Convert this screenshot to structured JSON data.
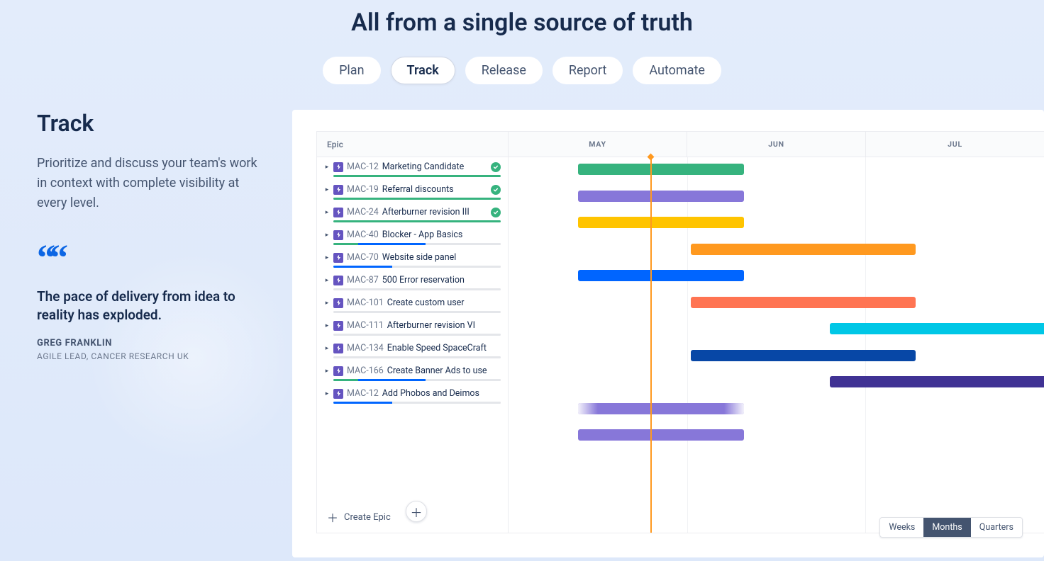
{
  "header": {
    "title": "All from a single source of truth",
    "tabs": [
      "Plan",
      "Track",
      "Release",
      "Report",
      "Automate"
    ],
    "active_tab": "Track"
  },
  "left": {
    "heading": "Track",
    "description": "Prioritize and discuss your team's work in context with complete visibility at every level.",
    "quote": {
      "text": "The pace of delivery from idea to reality has exploded.",
      "name": "GREG FRANKLIN",
      "role": "AGILE LEAD, CANCER RESEARCH UK"
    }
  },
  "roadmap": {
    "epic_header": "Epic",
    "create_epic_label": "Create Epic",
    "months": [
      "MAY",
      "JUN",
      "JUL"
    ],
    "today_pct": 26.5,
    "zoom": {
      "options": [
        "Weeks",
        "Months",
        "Quarters"
      ],
      "active": "Months"
    },
    "colors": {
      "green": "#36b37e",
      "purple": "#8777d9",
      "yellow": "#ffc400",
      "orange": "#ff991f",
      "blue": "#0065ff",
      "coral": "#ff7452",
      "teal": "#00c7e6",
      "navy": "#0747a6",
      "indigo": "#403294"
    },
    "epics": [
      {
        "key": "MAC-12",
        "title": "Marketing Candidate",
        "done": true,
        "progress": [
          [
            "#36b37e",
            100
          ]
        ],
        "bar": {
          "color": "green",
          "start_pct": 13,
          "width_pct": 31
        }
      },
      {
        "key": "MAC-19",
        "title": "Referral discounts",
        "done": true,
        "progress": [
          [
            "#36b37e",
            100
          ]
        ],
        "bar": {
          "color": "purple",
          "start_pct": 13,
          "width_pct": 31
        }
      },
      {
        "key": "MAC-24",
        "title": "Afterburner revision III",
        "done": true,
        "progress": [
          [
            "#36b37e",
            100
          ]
        ],
        "bar": {
          "color": "yellow",
          "start_pct": 13,
          "width_pct": 31
        }
      },
      {
        "key": "MAC-40",
        "title": "Blocker - App Basics",
        "done": false,
        "progress": [
          [
            "#36b37e",
            15
          ],
          [
            "#0065ff",
            40
          ],
          [
            "#e4e6ea",
            45
          ]
        ],
        "bar": {
          "color": "orange",
          "start_pct": 34,
          "width_pct": 42
        }
      },
      {
        "key": "MAC-70",
        "title": "Website side panel",
        "done": false,
        "progress": [
          [
            "#0065ff",
            35
          ],
          [
            "#e4e6ea",
            65
          ]
        ],
        "bar": {
          "color": "blue",
          "start_pct": 13,
          "width_pct": 31
        }
      },
      {
        "key": "MAC-87",
        "title": "500 Error reservation",
        "done": false,
        "progress": [
          [
            "#e4e6ea",
            100
          ]
        ],
        "bar": {
          "color": "coral",
          "start_pct": 34,
          "width_pct": 42
        }
      },
      {
        "key": "MAC-101",
        "title": "Create custom user",
        "done": false,
        "progress": [
          [
            "#e4e6ea",
            100
          ]
        ],
        "bar": {
          "color": "teal",
          "start_pct": 60,
          "width_pct": 42
        }
      },
      {
        "key": "MAC-111",
        "title": "Afterburner revision VI",
        "done": false,
        "progress": [
          [
            "#e4e6ea",
            100
          ]
        ],
        "bar": {
          "color": "navy",
          "start_pct": 34,
          "width_pct": 42
        }
      },
      {
        "key": "MAC-134",
        "title": "Enable Speed SpaceCraft",
        "done": false,
        "progress": [
          [
            "#e4e6ea",
            100
          ]
        ],
        "bar": {
          "color": "indigo",
          "start_pct": 60,
          "width_pct": 42
        }
      },
      {
        "key": "MAC-166",
        "title": "Create Banner Ads to use",
        "done": false,
        "progress": [
          [
            "#36b37e",
            15
          ],
          [
            "#0065ff",
            40
          ],
          [
            "#e4e6ea",
            45
          ]
        ],
        "bar": {
          "color": "purple",
          "start_pct": 13,
          "width_pct": 31,
          "faded": true
        }
      },
      {
        "key": "MAC-12",
        "title": "Add Phobos and Deimos",
        "done": false,
        "progress": [
          [
            "#0065ff",
            35
          ],
          [
            "#e4e6ea",
            65
          ]
        ],
        "bar": {
          "color": "purple",
          "start_pct": 13,
          "width_pct": 31
        }
      }
    ]
  }
}
